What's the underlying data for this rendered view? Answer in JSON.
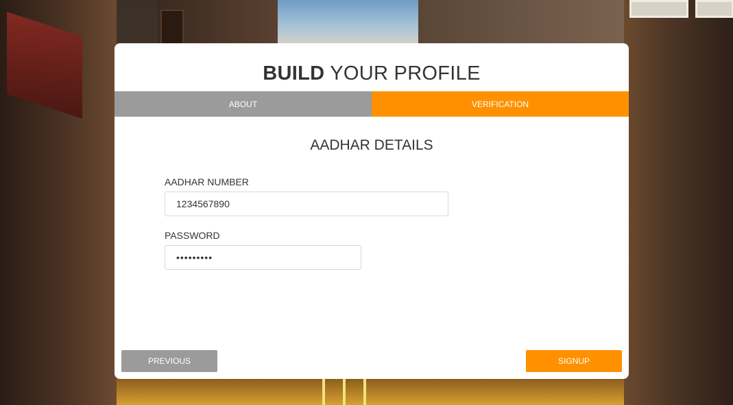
{
  "header": {
    "title_bold": "BUILD",
    "title_rest": "YOUR PROFILE"
  },
  "tabs": [
    {
      "label": "ABOUT",
      "active": false
    },
    {
      "label": "VERIFICATION",
      "active": true
    }
  ],
  "form": {
    "section_title": "AADHAR DETAILS",
    "aadhar": {
      "label": "AADHAR NUMBER",
      "value": "1234567890"
    },
    "password": {
      "label": "PASSWORD",
      "value": "•••••••••"
    }
  },
  "footer": {
    "previous_label": "PREVIOUS",
    "signup_label": "SIGNUP"
  },
  "colors": {
    "accent": "#ff9100",
    "inactive": "#9b9b9b",
    "text": "#333333",
    "card": "#ffffff"
  }
}
